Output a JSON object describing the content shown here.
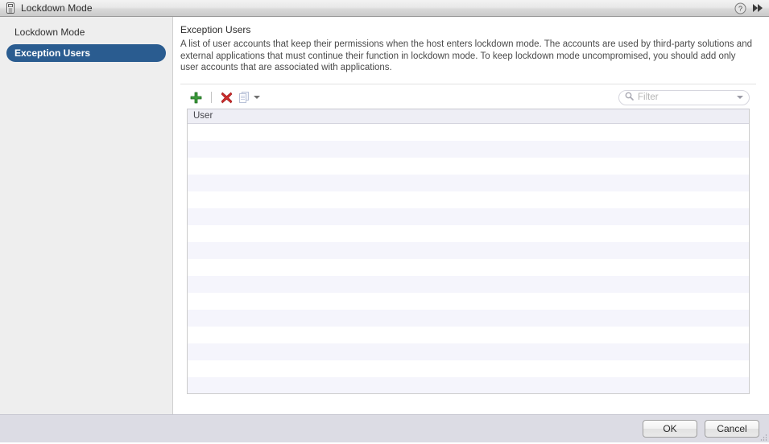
{
  "window": {
    "title": "Lockdown Mode",
    "icon": "host-icon",
    "help_icon": "help-icon",
    "expand_icon": "fast-forward-icon"
  },
  "sidebar": {
    "items": [
      {
        "label": "Lockdown Mode",
        "selected": false
      },
      {
        "label": "Exception Users",
        "selected": true
      }
    ]
  },
  "content": {
    "title": "Exception Users",
    "description": "A list of user accounts that keep their permissions when the host enters lockdown mode. The accounts are used by third-party solutions and external applications that must continue their function in lockdown mode. To keep lockdown mode uncompromised, you should add only user accounts that are associated with applications."
  },
  "toolbar": {
    "add": {
      "name": "add-user-button",
      "icon": "plus-icon",
      "title": "Add User",
      "enabled": true
    },
    "remove": {
      "name": "remove-user-button",
      "icon": "delete-x-icon",
      "title": "Remove User",
      "enabled": true
    },
    "copy": {
      "name": "copy-button",
      "icon": "copy-icon",
      "title": "Copy",
      "enabled": false
    }
  },
  "filter": {
    "placeholder": "Filter",
    "value": "",
    "icon": "search-icon",
    "dropdown_icon": "chevron-down-icon"
  },
  "table": {
    "columns": [
      "User"
    ],
    "rows": [],
    "empty_row_count": 16,
    "colors": {
      "header_bg": "#eeeef5",
      "row_bg": "#ffffff",
      "row_alt_bg": "#f5f5fc",
      "border": "#cccccc"
    }
  },
  "footer": {
    "ok_label": "OK",
    "cancel_label": "Cancel"
  },
  "theme": {
    "accent": "#2a5c90",
    "add_green": "#3a9a3a",
    "remove_red": "#cc2b2b",
    "sidebar_bg": "#eeeeee",
    "footer_bg": "#dcdce4"
  }
}
